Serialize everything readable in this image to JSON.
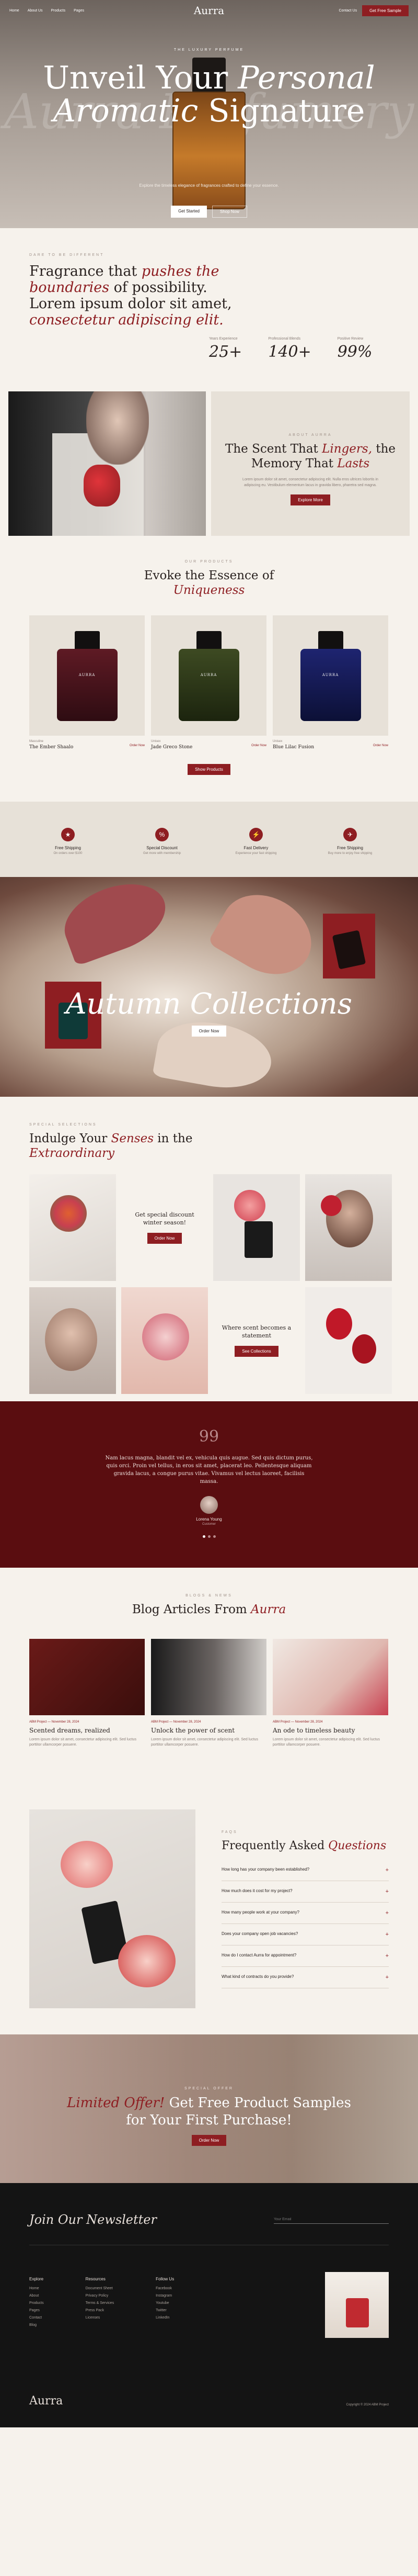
{
  "nav": {
    "links": [
      "Home",
      "About Us",
      "Products",
      "Pages"
    ],
    "logo": "Aurra",
    "contact": "Contact Us",
    "cta": "Get Free Sample"
  },
  "hero": {
    "eyebrow": "THE LUXURY PERFUME",
    "title_a": "Unveil Your ",
    "title_b": "Personal",
    "title_c": "Aromatic",
    "title_d": " Signature",
    "ghost": "Aurra Perfumery",
    "desc": "Explore the timeless elegance of fragrances crafted to define your essence.",
    "btn1": "Get Started",
    "btn2": "Shop Now"
  },
  "about": {
    "eyebrow": "DARE TO BE DIFFERENT",
    "t1": "Fragrance that ",
    "t2": "pushes the boundaries",
    "t3": " of possibility. Lorem ipsum dolor sit amet, ",
    "t4": "consectetur adipiscing elit.",
    "stats": [
      {
        "label": "Years Experience",
        "value": "25+"
      },
      {
        "label": "Professional Blends",
        "value": "140+"
      },
      {
        "label": "Positive Review",
        "value": "99%"
      }
    ]
  },
  "scent": {
    "eyebrow": "ABOUT AURRA",
    "h1": "The Scent That ",
    "h2": "Lingers,",
    "h3": " the Memory That ",
    "h4": "Lasts",
    "body": "Lorem ipsum dolor sit amet, consectetur adipiscing elit. Nulla eros ultrices lobortis in adipiscing eu. Vestibulum elementum lacus in gravida libero, pharetra sed magna.",
    "btn": "Explore More"
  },
  "products": {
    "eyebrow": "OUR PRODUCTS",
    "h1": "Evoke the Essence of ",
    "h2": "Uniqueness",
    "items": [
      {
        "cat": "Masculine",
        "name": "The Ember Shaalo",
        "buy": "Order Now",
        "label": "AURRA"
      },
      {
        "cat": "Unisex",
        "name": "Jade Greco Stone",
        "buy": "Order Now",
        "label": "AURRA"
      },
      {
        "cat": "Unisex",
        "name": "Blue Lilac Fusion",
        "buy": "Order Now",
        "label": "AURRA"
      }
    ],
    "more": "Show Products"
  },
  "features": [
    {
      "icon": "★",
      "t": "Free Shipping",
      "s": "On orders over $100"
    },
    {
      "icon": "%",
      "t": "Special Discount",
      "s": "Get more with membership"
    },
    {
      "icon": "⚡",
      "t": "Fast Delivery",
      "s": "Experience your fast shipping"
    },
    {
      "icon": "✈",
      "t": "Free Shipping",
      "s": "Buy more to enjoy free shipping"
    }
  ],
  "autumn": {
    "title": "Autumn Collections",
    "btn": "Order Now"
  },
  "senses": {
    "eyebrow": "SPECIAL SELECTIONS",
    "h1": "Indulge Your ",
    "h2": "Senses",
    "h3": " in the ",
    "h4": "Extraordinary",
    "c1": "Get special discount winter season!",
    "c1btn": "Order Now",
    "c2": "Where scent becomes a statement",
    "c2btn": "See Collections"
  },
  "testi": {
    "q": "99",
    "text": "Nam lacus magna, blandit vel ex, vehicula quis augue. Sed quis dictum purus, quis orci. Proin vel tellus, in eros sit amet, placerat leo. Pellentesque aliquam gravida lacus, a congue purus vitae. Vivamus vel lectus laoreet, facilisis massa.",
    "name": "Lorena Young",
    "role": "Customer"
  },
  "blog": {
    "eyebrow": "BLOGS & NEWS",
    "h1": "Blog Articles From ",
    "h2": "Aurra",
    "posts": [
      {
        "meta": "ABM Project   —   November 28, 2024",
        "t": "Scented dreams, realized",
        "ex": "Lorem ipsum dolor sit amet, consectetur adipiscing elit. Sed luctus porttitor ullamcorper posuere."
      },
      {
        "meta": "ABM Project   —   November 28, 2024",
        "t": "Unlock the power of scent",
        "ex": "Lorem ipsum dolor sit amet, consectetur adipiscing elit. Sed luctus porttitor ullamcorper posuere."
      },
      {
        "meta": "ABM Project   —   November 28, 2024",
        "t": "An ode to timeless beauty",
        "ex": "Lorem ipsum dolor sit amet, consectetur adipiscing elit. Sed luctus porttitor ullamcorper posuere."
      }
    ]
  },
  "faq": {
    "eyebrow": "FAQS",
    "h1": "Frequently Asked ",
    "h2": "Questions",
    "items": [
      "How long has your company been established?",
      "How much does it cost for my project?",
      "How many people work at your company?",
      "Does your company open job vacancies?",
      "How do I contact Aurra for appointment?",
      "What kind of contracts do you provide?"
    ]
  },
  "offer": {
    "eyebrow": "SPECIAL OFFER",
    "h1": "Limited Offer!",
    "h2": " Get Free Product Samples",
    "h3": "for Your First Purchase!",
    "btn": "Order Now"
  },
  "footer": {
    "nl": "Join Our Newsletter",
    "email": "Your Email",
    "cols": [
      {
        "h": "Explore",
        "items": [
          "Home",
          "About",
          "Products",
          "Pages",
          "Contact",
          "Blog"
        ]
      },
      {
        "h": "Resources",
        "items": [
          "Document Sheet",
          "Privacy Policy",
          "Terms & Services",
          "Press Pack",
          "Licenses"
        ]
      },
      {
        "h": "Follow Us",
        "items": [
          "Facebook",
          "Instagram",
          "Youtube",
          "Twitter",
          "LinkedIn"
        ]
      }
    ],
    "logo": "Aurra",
    "copy": "Copyright © 2024 ABM Project"
  }
}
